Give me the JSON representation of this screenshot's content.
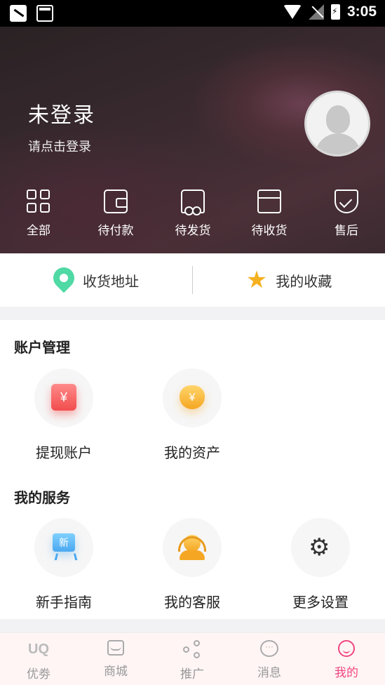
{
  "status_bar": {
    "time": "3:05"
  },
  "header": {
    "user_name": "未登录",
    "login_hint": "请点击登录",
    "orders": [
      {
        "label": "全部",
        "icon": "grid-icon"
      },
      {
        "label": "待付款",
        "icon": "wallet-icon"
      },
      {
        "label": "待发货",
        "icon": "truck-icon"
      },
      {
        "label": "待收货",
        "icon": "box-icon"
      },
      {
        "label": "售后",
        "icon": "shield-check-icon"
      }
    ]
  },
  "quick_links": {
    "address": {
      "label": "收货地址",
      "icon": "location-pin-icon",
      "color": "#4fd9a4"
    },
    "favorites": {
      "label": "我的收藏",
      "icon": "star-icon",
      "color": "#f5b120"
    }
  },
  "account": {
    "title": "账户管理",
    "items": [
      {
        "label": "提现账户",
        "icon": "withdraw-account-icon",
        "glyph": "¥"
      },
      {
        "label": "我的资产",
        "icon": "money-bag-icon",
        "glyph": "¥"
      }
    ]
  },
  "services": {
    "title": "我的服务",
    "items": [
      {
        "label": "新手指南",
        "icon": "guide-board-icon",
        "glyph": "新"
      },
      {
        "label": "我的客服",
        "icon": "customer-service-icon"
      },
      {
        "label": "更多设置",
        "icon": "gear-icon",
        "glyph": "⚙"
      }
    ]
  },
  "tabbar": {
    "items": [
      {
        "label": "优劵",
        "icon": "coupon-icon",
        "glyph": "UQ",
        "active": false
      },
      {
        "label": "商城",
        "icon": "store-icon",
        "active": false
      },
      {
        "label": "推广",
        "icon": "share-icon",
        "active": false
      },
      {
        "label": "消息",
        "icon": "message-icon",
        "glyph": "···",
        "active": false
      },
      {
        "label": "我的",
        "icon": "profile-icon",
        "active": true
      }
    ],
    "active_color": "#f0467f"
  }
}
